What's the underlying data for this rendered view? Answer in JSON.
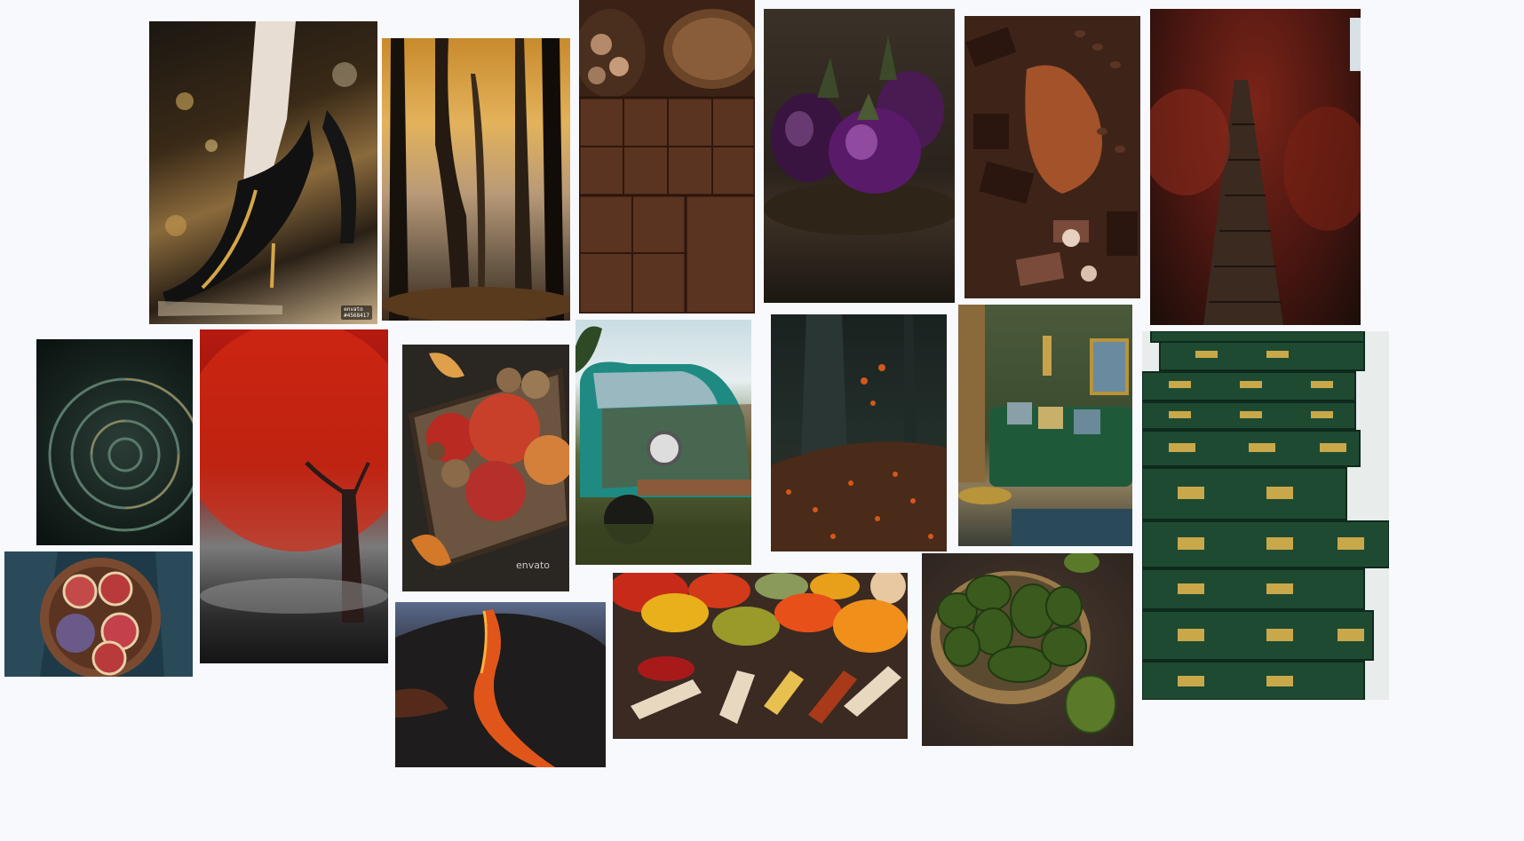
{
  "tiles": [
    {
      "name": "tile-golden-heels",
      "subject": "ornate black and gold high heel shoes"
    },
    {
      "name": "tile-autumn-forest",
      "subject": "misty autumn forest with golden leaves"
    },
    {
      "name": "tile-chocolate-cocoa",
      "subject": "chocolate bars with cocoa powder and nuts"
    },
    {
      "name": "tile-eggplants",
      "subject": "purple eggplants on a wooden table"
    },
    {
      "name": "tile-chocolate-spread",
      "subject": "assorted chocolates and cocoa beans"
    },
    {
      "name": "tile-red-forest-path",
      "subject": "wooden stairway through red foliage"
    },
    {
      "name": "tile-spiral-staircase",
      "subject": "dark green spiral staircase"
    },
    {
      "name": "tile-red-tree",
      "subject": "red autumn tree in fog"
    },
    {
      "name": "tile-apples-nuts",
      "subject": "apples and walnuts in a wooden basket"
    },
    {
      "name": "tile-rusty-car",
      "subject": "rusty turquoise vintage car"
    },
    {
      "name": "tile-dark-forest",
      "subject": "dark forest floor with orange leaves"
    },
    {
      "name": "tile-green-living-room",
      "subject": "green velvet sofa living room"
    },
    {
      "name": "tile-green-books",
      "subject": "stack of green and gold leather books"
    },
    {
      "name": "tile-figs",
      "subject": "halved figs in a bowl"
    },
    {
      "name": "tile-lava",
      "subject": "lava flowing over black volcanic rock"
    },
    {
      "name": "tile-spices",
      "subject": "bowls and scoops of colorful spices"
    },
    {
      "name": "tile-avocados",
      "subject": "avocados in a metal bowl"
    }
  ],
  "watermarks": {
    "heels_badge": "envato\n#4568417",
    "apples": "envato"
  },
  "colors": {
    "background": "#f8f9fc"
  }
}
